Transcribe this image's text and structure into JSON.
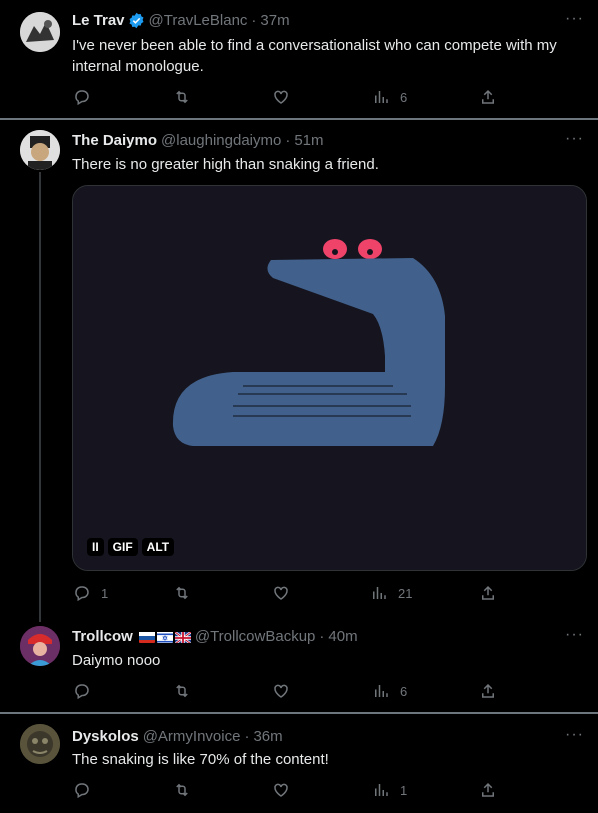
{
  "tweets": [
    {
      "name": "Le Trav",
      "handle": "@TravLeBlanc",
      "time": "37m",
      "text": "I've never been able to find a conversationalist who can compete with my internal monologue.",
      "replies": "",
      "retweets": "",
      "likes": "",
      "views": "6",
      "verified": true
    },
    {
      "name": "The Daiymo",
      "handle": "@laughingdaiymo",
      "time": "51m",
      "text": "There is no greater high than snaking a friend.",
      "replies": "1",
      "retweets": "",
      "likes": "",
      "views": "21",
      "media": {
        "gif_badge": "GIF",
        "alt_badge": "ALT",
        "pause_icon": "pause-icon"
      }
    },
    {
      "name": "Trollcow",
      "handle": "@TrollcowBackup",
      "time": "40m",
      "text": "Daiymo nooo",
      "replies": "",
      "retweets": "",
      "likes": "",
      "views": "6",
      "flags": [
        "russia-flag",
        "israel-flag",
        "uk-flag"
      ]
    },
    {
      "name": "Dyskolos",
      "handle": "@ArmyInvoice",
      "time": "36m",
      "text": "The snaking is like 70% of the content!",
      "replies": "",
      "retweets": "",
      "likes": "",
      "views": "1"
    }
  ],
  "colors": {
    "background": "#000000",
    "text": "#e7e9ea",
    "muted": "#71767b",
    "verified": "#1d9bf0",
    "snake": "#41618c",
    "snake_eyes": "#f0436a"
  }
}
